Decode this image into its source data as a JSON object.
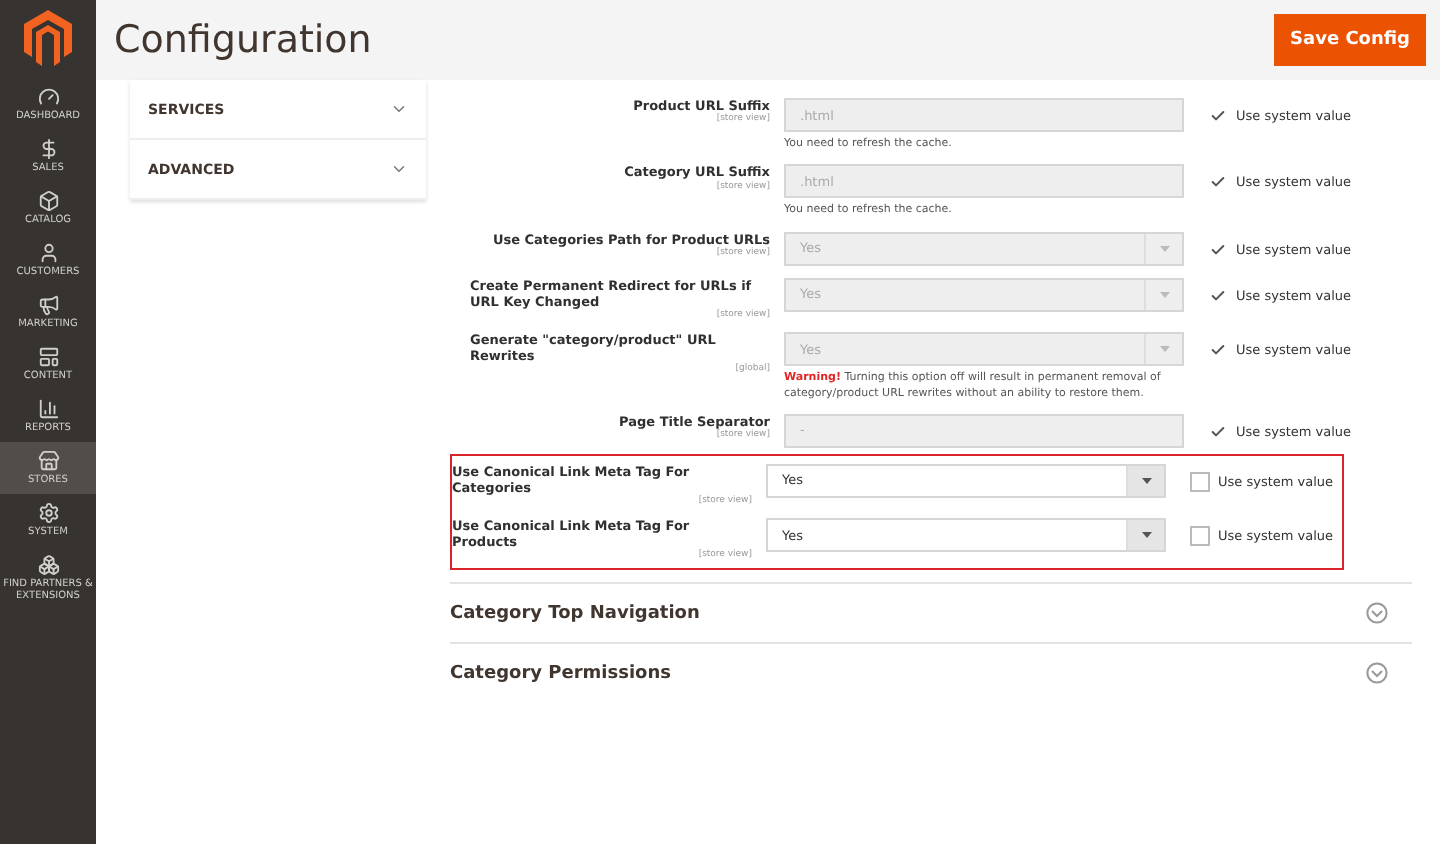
{
  "sidebar": {
    "items": [
      {
        "label": "DASHBOARD",
        "selected": false
      },
      {
        "label": "SALES",
        "selected": false
      },
      {
        "label": "CATALOG",
        "selected": false
      },
      {
        "label": "CUSTOMERS",
        "selected": false
      },
      {
        "label": "MARKETING",
        "selected": false
      },
      {
        "label": "CONTENT",
        "selected": false
      },
      {
        "label": "REPORTS",
        "selected": false
      },
      {
        "label": "STORES",
        "selected": true
      },
      {
        "label": "SYSTEM",
        "selected": false
      },
      {
        "label": "FIND PARTNERS & EXTENSIONS",
        "selected": false
      }
    ]
  },
  "header": {
    "title": "Configuration",
    "save_button": "Save Config"
  },
  "tabs": [
    {
      "label": "SERVICES",
      "expanded": false
    },
    {
      "label": "ADVANCED",
      "expanded": false
    }
  ],
  "fields": [
    {
      "label": "Product URL Suffix",
      "scope": "[store view]",
      "kind": "text",
      "value": ".html",
      "disabled": true,
      "use_system": "Use system value",
      "checked": true,
      "note": {
        "text": "You need to refresh the cache."
      },
      "highlighted": false
    },
    {
      "label": "Category URL Suffix",
      "scope": "[store view]",
      "kind": "text",
      "value": ".html",
      "disabled": true,
      "use_system": "Use system value",
      "checked": true,
      "note": {
        "text": "You need to refresh the cache."
      },
      "highlighted": false
    },
    {
      "label": "Use Categories Path for Product URLs",
      "scope": "[store view]",
      "kind": "select",
      "value": "Yes",
      "disabled": true,
      "use_system": "Use system value",
      "checked": true,
      "highlighted": false
    },
    {
      "label": "Create Permanent Redirect for URLs if URL Key Changed",
      "scope": "[store view]",
      "kind": "select",
      "value": "Yes",
      "disabled": true,
      "use_system": "Use system value",
      "checked": true,
      "highlighted": false
    },
    {
      "label": "Generate \"category/product\" URL Rewrites",
      "scope": "[global]",
      "kind": "select",
      "value": "Yes",
      "disabled": true,
      "use_system": "Use system value",
      "checked": true,
      "note": {
        "warning": "Warning!",
        "text": "Turning this option off will result in permanent removal of category/product URL rewrites without an ability to restore them."
      },
      "highlighted": false
    },
    {
      "label": "Page Title Separator",
      "scope": "[store view]",
      "kind": "text",
      "value": "-",
      "disabled": true,
      "use_system": "Use system value",
      "checked": true,
      "highlighted": false
    },
    {
      "label": "Use Canonical Link Meta Tag For Categories",
      "scope": "[store view]",
      "kind": "select",
      "value": "Yes",
      "disabled": false,
      "use_system": "Use system value",
      "checked": false,
      "highlighted": true
    },
    {
      "label": "Use Canonical Link Meta Tag For Products",
      "scope": "[store view]",
      "kind": "select",
      "value": "Yes",
      "disabled": false,
      "use_system": "Use system value",
      "checked": false,
      "highlighted": true
    }
  ],
  "sections": [
    {
      "title": "Category Top Navigation",
      "expanded": false
    },
    {
      "title": "Category Permissions",
      "expanded": false
    }
  ]
}
